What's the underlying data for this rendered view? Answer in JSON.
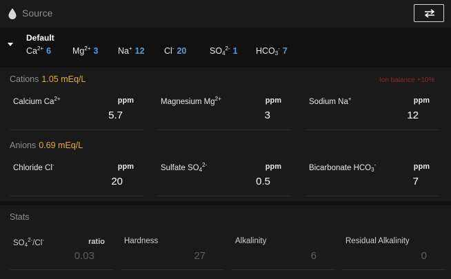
{
  "header": {
    "title": "Source",
    "swap_icon": "swap-arrows-icon",
    "drop_icon": "water-drop-icon"
  },
  "profile": {
    "name": "Default",
    "ions": [
      {
        "label": "Ca",
        "sup": "2+",
        "sub": "",
        "value": "6"
      },
      {
        "label": "Mg",
        "sup": "2+",
        "sub": "",
        "value": "3"
      },
      {
        "label": "Na",
        "sup": "+",
        "sub": "",
        "value": "12"
      },
      {
        "label": "Cl",
        "sup": "-",
        "sub": "",
        "value": "20"
      },
      {
        "label": "SO",
        "sup": "2-",
        "sub": "4",
        "value": "1"
      },
      {
        "label": "HCO",
        "sup": "-",
        "sub": "3",
        "value": "7"
      }
    ]
  },
  "cations": {
    "title": "Cations",
    "meq": "1.05 mEq/L",
    "balance": "Ion balance +10%",
    "fields": [
      {
        "label": "Calcium Ca",
        "sup": "2+",
        "sub": "",
        "unit": "ppm",
        "value": "5.7"
      },
      {
        "label": "Magnesium Mg",
        "sup": "2+",
        "sub": "",
        "unit": "ppm",
        "value": "3"
      },
      {
        "label": "Sodium Na",
        "sup": "+",
        "sub": "",
        "unit": "ppm",
        "value": "12"
      }
    ]
  },
  "anions": {
    "title": "Anions",
    "meq": "0.69 mEq/L",
    "fields": [
      {
        "label": "Chloride Cl",
        "sup": "-",
        "sub": "",
        "unit": "ppm",
        "value": "20"
      },
      {
        "label": "Sulfate SO",
        "sup": "2-",
        "sub": "4",
        "unit": "ppm",
        "value": "0.5"
      },
      {
        "label": "Bicarbonate HCO",
        "sup": "-",
        "sub": "3",
        "unit": "ppm",
        "value": "7"
      }
    ]
  },
  "stats": {
    "title": "Stats",
    "ratio": {
      "label_a": "SO",
      "sub_a": "4",
      "sup_a": "2-",
      "label_b": "/Cl",
      "sup_b": "-",
      "unit": "ratio",
      "value": "0.03"
    },
    "items": [
      {
        "label": "Hardness",
        "value": "27"
      },
      {
        "label": "Alkalinity",
        "value": "6"
      },
      {
        "label": "Residual Alkalinity",
        "value": "0"
      }
    ]
  },
  "colors": {
    "accent_value": "#4f9fe0",
    "meq": "#e6a93a",
    "balance_warning": "#8b2a2a",
    "panel": "#1a1a1a",
    "background": "#111111"
  }
}
